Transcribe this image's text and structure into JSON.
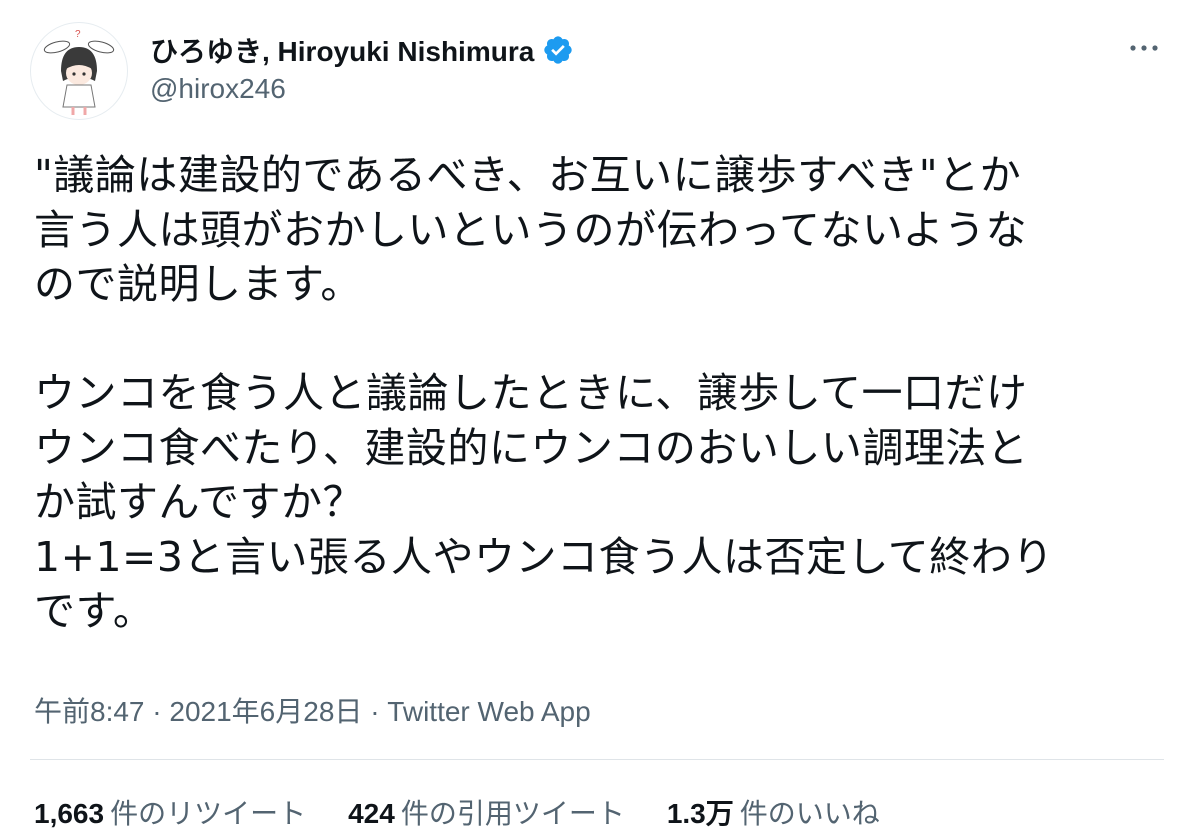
{
  "author": {
    "display_name": "ひろゆき, Hiroyuki Nishimura",
    "handle": "@hirox246",
    "verified": true,
    "avatar_icon": "avatar-illustration-bunny-ears"
  },
  "menu": {
    "more_icon": "more-horizontal-icon"
  },
  "tweet": {
    "lines": [
      "\"議論は建設的であるべき、お互いに譲歩すべき\"とか",
      "言う人は頭がおかしいというのが伝わってないような",
      "ので説明します。",
      "",
      "ウンコを食う人と議論したときに、譲歩して一口だけ",
      "ウンコ食べたり、建設的にウンコのおいしい調理法と",
      "か試すんですか？",
      "1+1=3と言い張る人やウンコ食う人は否定して終わり",
      "です。"
    ]
  },
  "meta": {
    "time": "午前8:47",
    "separator": "·",
    "date": "2021年6月28日",
    "source": "Twitter Web App"
  },
  "stats": [
    {
      "value": "1,663",
      "label": "件のリツイート"
    },
    {
      "value": "424",
      "label": "件の引用ツイート"
    },
    {
      "value": "1.3万",
      "label": "件のいいね"
    }
  ],
  "colors": {
    "text": "#0f1419",
    "secondary": "#536471",
    "verified": "#1d9bf0"
  }
}
